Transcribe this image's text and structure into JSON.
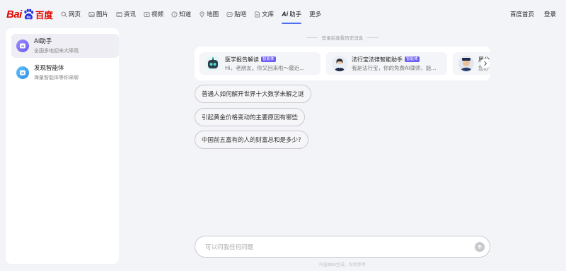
{
  "logo": {
    "latin": "Bai",
    "chinese": "百度"
  },
  "nav": [
    {
      "label": "网页",
      "icon": "search-icon"
    },
    {
      "label": "图片",
      "icon": "image-icon"
    },
    {
      "label": "资讯",
      "icon": "news-icon"
    },
    {
      "label": "视频",
      "icon": "video-icon"
    },
    {
      "label": "知道",
      "icon": "question-icon"
    },
    {
      "label": "地图",
      "icon": "map-icon"
    },
    {
      "label": "贴吧",
      "icon": "tieba-icon"
    },
    {
      "label": "文库",
      "icon": "doc-icon"
    },
    {
      "label": "助手",
      "icon": "ai-icon",
      "prefix": "Ai",
      "active": true
    },
    {
      "label": "更多",
      "icon": ""
    }
  ],
  "header_right": {
    "home": "百度首页",
    "login": "登录"
  },
  "sidebar": {
    "items": [
      {
        "title": "AI助手",
        "subtitle": "全国多地迎来大降雨",
        "selected": true,
        "color": "#7b6cf6"
      },
      {
        "title": "发现智能体",
        "subtitle": "海量智能体等你来聊",
        "selected": false,
        "color": "#3aa6f0"
      }
    ]
  },
  "history_hint": "登录后查看历史消息",
  "agents": [
    {
      "name": "医学报告解读",
      "badge": "智能体",
      "desc": "Hi，老朋友。你又回来啦～最近..."
    },
    {
      "name": "法行宝法律智能助手",
      "badge": "智能体",
      "desc": "我是法行宝，你的免费AI律师，能..."
    },
    {
      "name": "周公",
      "badge": "",
      "desc": "您好"
    }
  ],
  "suggestions": [
    "普通人如何解开世界十大数学未解之谜",
    "引起黄金价格变动的主要原因有哪些",
    "中国前五富有的人的财富总和是多少?"
  ],
  "input": {
    "placeholder": "可以问我任何问题"
  },
  "footnote": "内容由AI生成，仅供参考",
  "colors": {
    "brand_red": "#e10601",
    "accent": "#4e6ef2",
    "badge": "#6b5cf6"
  }
}
